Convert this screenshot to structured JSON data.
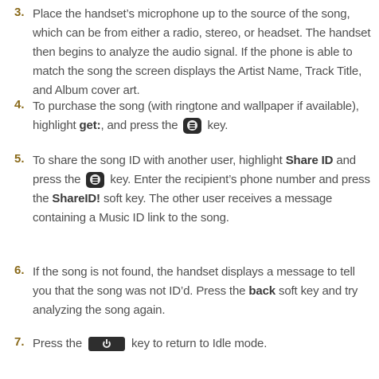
{
  "steps": [
    {
      "num": "3.",
      "segments": [
        {
          "t": "text",
          "v": "Place the handset’s microphone up to the source of the song, which can be from either a radio, stereo, or headset. The handset then begins to analyze the audio signal. If the phone is able to match the song the screen displays the Artist Name, Track Title, and Album cover art."
        }
      ]
    },
    {
      "num": "4.",
      "segments": [
        {
          "t": "text",
          "v": "To purchase the song (with ringtone and wallpaper if available), highlight "
        },
        {
          "t": "bold",
          "v": "get:"
        },
        {
          "t": "text",
          "v": ", and press the "
        },
        {
          "t": "icon",
          "v": "ok-key-icon"
        },
        {
          "t": "text",
          "v": " key."
        }
      ]
    },
    {
      "num": "5.",
      "segments": [
        {
          "t": "text",
          "v": "To share the song ID with another user, highlight "
        },
        {
          "t": "bold",
          "v": "Share ID"
        },
        {
          "t": "text",
          "v": " and press the "
        },
        {
          "t": "icon",
          "v": "ok-key-icon"
        },
        {
          "t": "text",
          "v": " key. Enter the recipient’s phone number and press the "
        },
        {
          "t": "bold",
          "v": "ShareID!"
        },
        {
          "t": "text",
          "v": " soft key. The other user receives a message containing a Music ID link to the song."
        }
      ]
    },
    {
      "num": "6.",
      "segments": [
        {
          "t": "text",
          "v": "If the song is not found, the handset displays a message to tell you that the song was not ID’d. Press the "
        },
        {
          "t": "bold",
          "v": "back"
        },
        {
          "t": "text",
          "v": " soft key and try analyzing the song again."
        }
      ]
    },
    {
      "num": "7.",
      "segments": [
        {
          "t": "text",
          "v": "Press the "
        },
        {
          "t": "icon",
          "v": "end-key-icon"
        },
        {
          "t": "text",
          "v": " key to return to Idle mode."
        }
      ]
    }
  ]
}
